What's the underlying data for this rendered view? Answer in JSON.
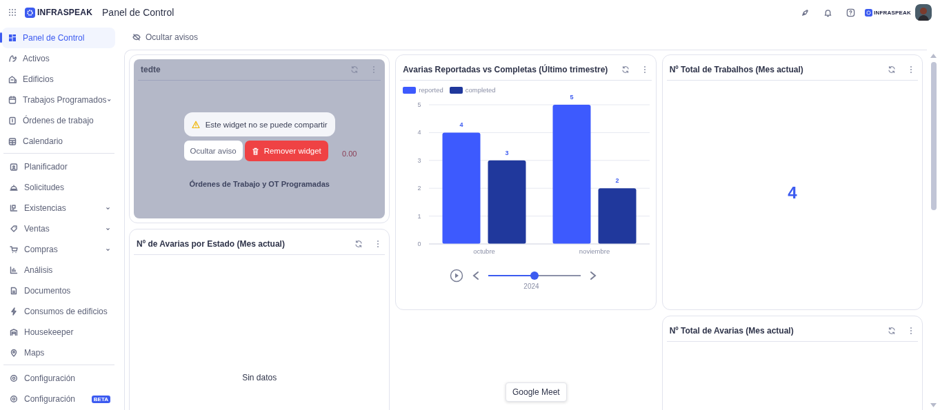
{
  "top_bar": {
    "brand": "INFRASPEAK",
    "page_title": "Panel de Control",
    "account_brand": "INFRASPEAK"
  },
  "sidebar": {
    "sections": [
      [
        {
          "label": "Panel de Control",
          "selected": true,
          "has_submenu": false
        },
        {
          "label": "Activos",
          "selected": false,
          "has_submenu": false
        },
        {
          "label": "Edificios",
          "selected": false,
          "has_submenu": false
        },
        {
          "label": "Trabajos Programados",
          "selected": false,
          "has_submenu": true
        },
        {
          "label": "Órdenes de trabajo",
          "selected": false,
          "has_submenu": false
        },
        {
          "label": "Calendario",
          "selected": false,
          "has_submenu": false
        }
      ],
      [
        {
          "label": "Planificador",
          "selected": false,
          "has_submenu": false
        },
        {
          "label": "Solicitudes",
          "selected": false,
          "has_submenu": false
        },
        {
          "label": "Existencias",
          "selected": false,
          "has_submenu": true
        },
        {
          "label": "Ventas",
          "selected": false,
          "has_submenu": true
        },
        {
          "label": "Compras",
          "selected": false,
          "has_submenu": true
        },
        {
          "label": "Análisis",
          "selected": false,
          "has_submenu": false
        },
        {
          "label": "Documentos",
          "selected": false,
          "has_submenu": false
        },
        {
          "label": "Consumos de edificios",
          "selected": false,
          "has_submenu": false
        },
        {
          "label": "Housekeeper",
          "selected": false,
          "has_submenu": false
        },
        {
          "label": "Maps",
          "selected": false,
          "has_submenu": false
        }
      ],
      [
        {
          "label": "Configuración",
          "selected": false,
          "has_submenu": false
        },
        {
          "label": "Configuración",
          "selected": false,
          "has_submenu": false,
          "badge": "BETA"
        }
      ]
    ]
  },
  "toolbar": {
    "hide_notices": "Ocultar avisos"
  },
  "columns": [
    [
      {
        "kind": "notice",
        "title": "tedte",
        "value": "0.00",
        "subtitle": "Órdenes de Trabajo y OT Programadas",
        "notice": "Este widget no se puede compartir",
        "hide_button": "Ocultar aviso",
        "remove_button": "Remover widget"
      },
      {
        "kind": "empty",
        "title": "Nº de Avarias por Estado (Mes actual)",
        "message": "Sin datos"
      }
    ],
    [
      {
        "kind": "bar_chart",
        "title": "Avarias Reportadas vs Completas (Último trimestre)",
        "chart_data": {
          "type": "bar",
          "categories": [
            "octubre",
            "noviembre"
          ],
          "series": [
            {
              "name": "reported",
              "color": "#3d5afe",
              "values": [
                4,
                5
              ]
            },
            {
              "name": "completed",
              "color": "#20389c",
              "values": [
                3,
                2
              ]
            }
          ],
          "ylim": [
            0,
            5
          ],
          "grid": true,
          "yticks": [
            0,
            1,
            2,
            3,
            4,
            5
          ],
          "data_labels": true
        },
        "timeline": {
          "year": "2024",
          "level": 0.5
        }
      }
    ],
    [
      {
        "kind": "counter",
        "title": "Nº Total de Trabalhos (Mes actual)",
        "value": "4"
      },
      {
        "kind": "blank",
        "title": "Nº Total de Avarias (Mes actual)"
      }
    ]
  ],
  "tooltip": "Google Meet"
}
